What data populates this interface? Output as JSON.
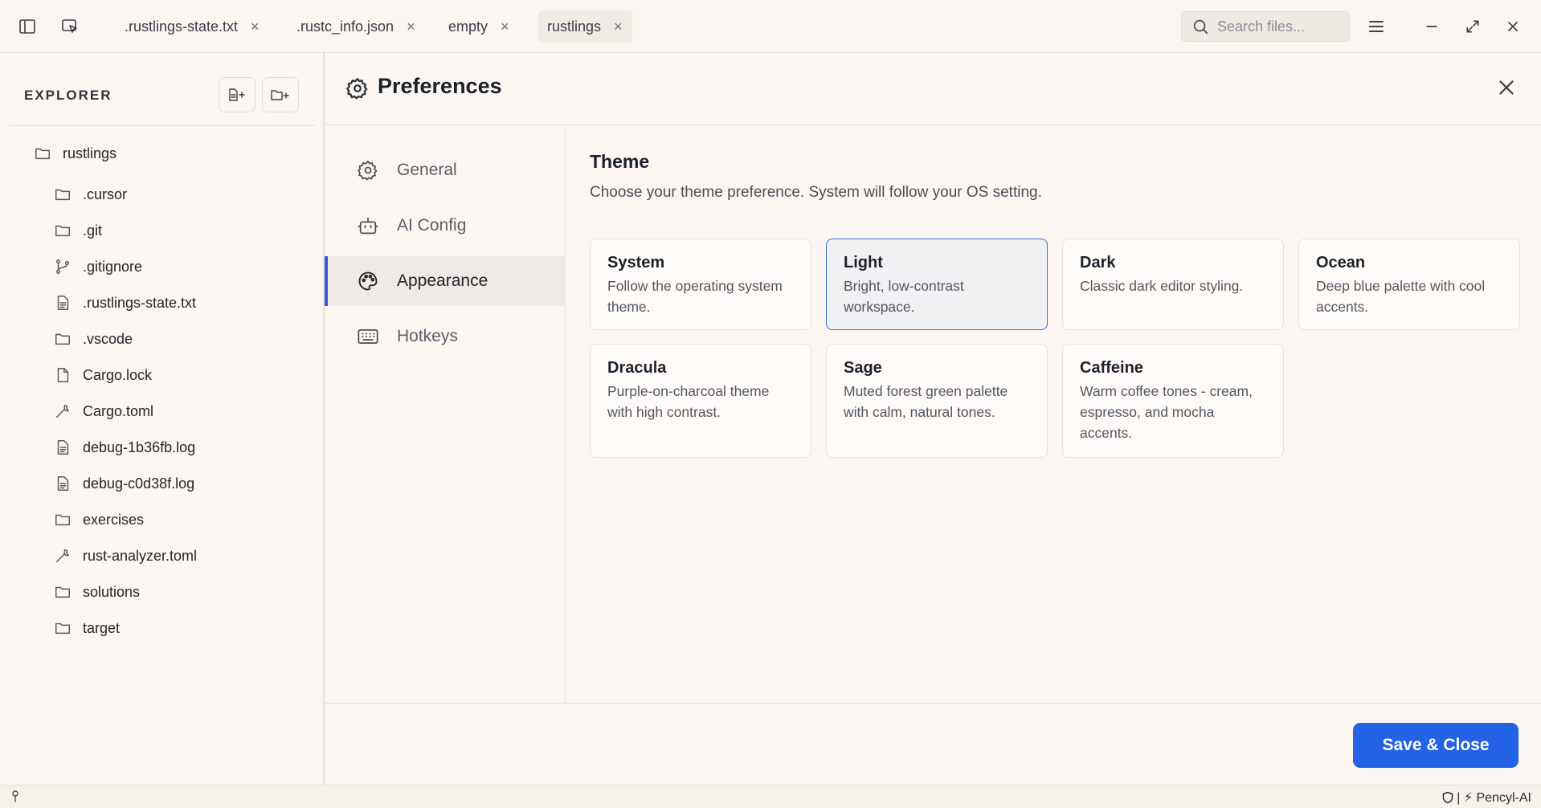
{
  "titlebar": {
    "tabs": [
      {
        "label": ".rustlings-state.txt",
        "close": "×"
      },
      {
        "label": ".rustc_info.json",
        "close": "×"
      },
      {
        "label": "empty",
        "close": "×"
      },
      {
        "label": "rustlings",
        "close": "×"
      }
    ],
    "search_placeholder": "Search files..."
  },
  "explorer": {
    "title": "EXPLORER",
    "root": "rustlings",
    "items": [
      {
        "label": ".cursor",
        "icon": "folder-icon"
      },
      {
        "label": ".git",
        "icon": "folder-icon"
      },
      {
        "label": ".gitignore",
        "icon": "git-branch-icon"
      },
      {
        "label": ".rustlings-state.txt",
        "icon": "file-text-icon"
      },
      {
        "label": ".vscode",
        "icon": "folder-icon"
      },
      {
        "label": "Cargo.lock",
        "icon": "file-icon"
      },
      {
        "label": "Cargo.toml",
        "icon": "wrench-icon"
      },
      {
        "label": "debug-1b36fb.log",
        "icon": "file-text-icon"
      },
      {
        "label": "debug-c0d38f.log",
        "icon": "file-text-icon"
      },
      {
        "label": "exercises",
        "icon": "folder-icon"
      },
      {
        "label": "rust-analyzer.toml",
        "icon": "wrench-icon"
      },
      {
        "label": "solutions",
        "icon": "folder-icon"
      },
      {
        "label": "target",
        "icon": "folder-icon"
      }
    ]
  },
  "preferences": {
    "title": "Preferences",
    "nav": [
      {
        "label": "General",
        "icon": "gear-icon"
      },
      {
        "label": "AI Config",
        "icon": "bot-icon"
      },
      {
        "label": "Appearance",
        "icon": "palette-icon",
        "active": true
      },
      {
        "label": "Hotkeys",
        "icon": "keyboard-icon"
      }
    ],
    "theme": {
      "title": "Theme",
      "description": "Choose your theme preference. System will follow your OS setting.",
      "selected": "Light",
      "options": [
        {
          "name": "System",
          "desc": "Follow the operating system theme."
        },
        {
          "name": "Light",
          "desc": "Bright, low-contrast workspace."
        },
        {
          "name": "Dark",
          "desc": "Classic dark editor styling."
        },
        {
          "name": "Ocean",
          "desc": "Deep blue palette with cool accents."
        },
        {
          "name": "Dracula",
          "desc": "Purple-on-charcoal theme with high contrast."
        },
        {
          "name": "Sage",
          "desc": "Muted forest green palette with calm, natural tones."
        },
        {
          "name": "Caffeine",
          "desc": "Warm coffee tones - cream, espresso, and mocha accents."
        }
      ]
    },
    "save_label": "Save & Close"
  },
  "statusbar": {
    "right_text": "| ⚡ Pencyl-AI"
  },
  "colors": {
    "accent": "#2563e6",
    "background": "#fbf6f1",
    "selected_border": "#3a6ed8"
  }
}
